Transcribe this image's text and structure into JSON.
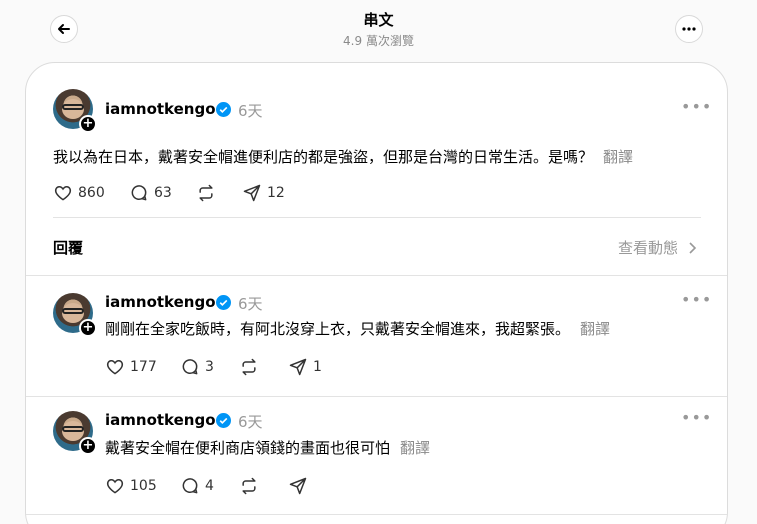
{
  "header": {
    "title": "串文",
    "views": "4.9 萬次瀏覽"
  },
  "main_post": {
    "username": "iamnotkengo",
    "time": "6天",
    "text": "我以為在日本，戴著安全帽進便利店的都是強盜，但那是台灣的日常生活。是嗎？",
    "translate": "翻譯",
    "likes": "860",
    "replies": "63",
    "shares": "12"
  },
  "replies_header": {
    "label": "回覆",
    "activity": "查看動態"
  },
  "replies": [
    {
      "username": "iamnotkengo",
      "time": "6天",
      "text": "剛剛在全家吃飯時，有阿北沒穿上衣，只戴著安全帽進來，我超緊張。",
      "translate": "翻譯",
      "likes": "177",
      "replies": "3",
      "shares": "1"
    },
    {
      "username": "iamnotkengo",
      "time": "6天",
      "text": "戴著安全帽在便利商店領錢的畫面也很可怕",
      "translate": "翻譯",
      "likes": "105",
      "replies": "4",
      "shares": ""
    }
  ],
  "colors": {
    "verified": "#0095f6",
    "muted": "#999999"
  }
}
